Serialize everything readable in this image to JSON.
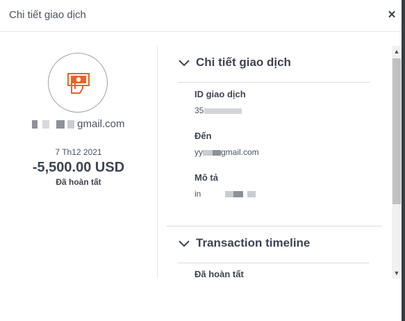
{
  "dialog": {
    "title": "Chi tiết giao dịch",
    "close_glyph": "×"
  },
  "summary": {
    "icon": "cash-payment-icon",
    "accent_color": "#e8622a",
    "email_suffix": "gmail.com",
    "date": "7 Th12 2021",
    "amount": "-5,500.00 USD",
    "status": "Đã hoàn tất"
  },
  "details": {
    "section_title": "Chi tiết giao dịch",
    "fields": [
      {
        "label": "ID giao dịch",
        "value": "35"
      },
      {
        "label": "Đến",
        "value_prefix": "yy",
        "value_suffix": "gmail.com"
      },
      {
        "label": "Mô tả",
        "value": "in"
      }
    ],
    "timeline_title": "Transaction timeline",
    "timeline_first_status": "Đã hoàn tất"
  },
  "scrollbar": {
    "up_glyph": "▲",
    "down_glyph": "▼"
  }
}
